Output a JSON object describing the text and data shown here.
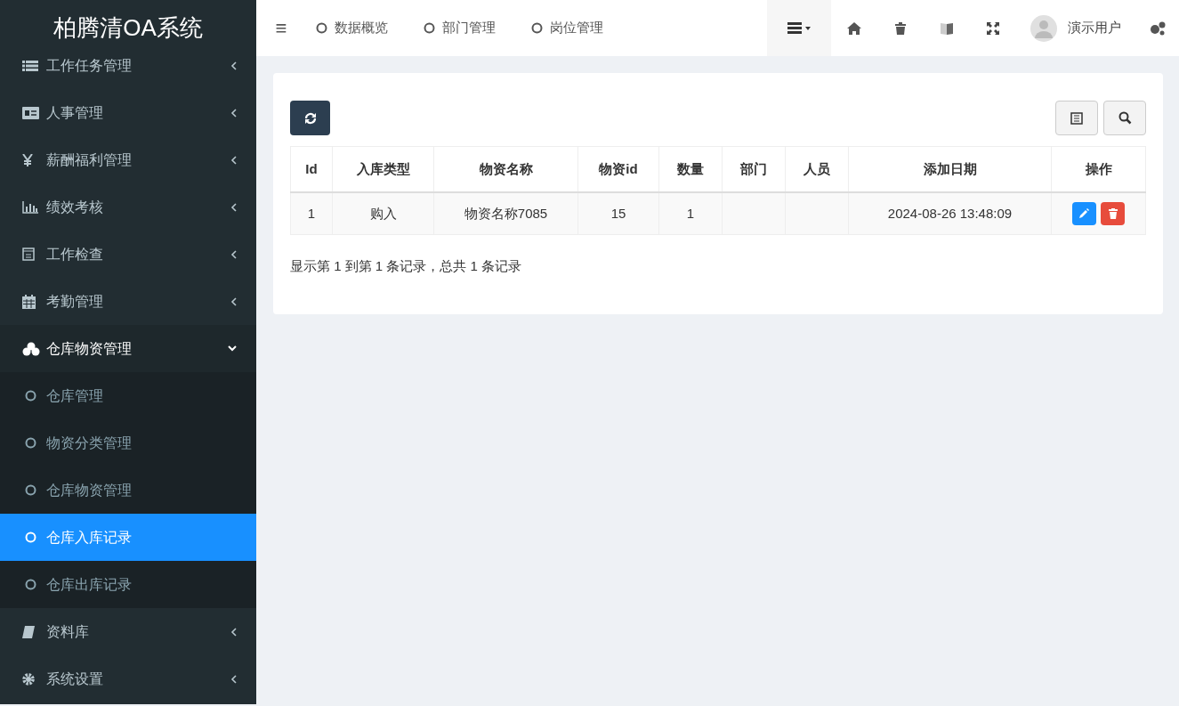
{
  "logo": "柏腾清OA系统",
  "sidebar": {
    "items": [
      {
        "label": "工作任务管理",
        "expanded": false
      },
      {
        "label": "人事管理",
        "expanded": false
      },
      {
        "label": "薪酬福利管理",
        "expanded": false
      },
      {
        "label": "绩效考核",
        "expanded": false
      },
      {
        "label": "工作检查",
        "expanded": false
      },
      {
        "label": "考勤管理",
        "expanded": false
      },
      {
        "label": "仓库物资管理",
        "expanded": true,
        "children": [
          {
            "label": "仓库管理",
            "selected": false
          },
          {
            "label": "物资分类管理",
            "selected": false
          },
          {
            "label": "仓库物资管理",
            "selected": false
          },
          {
            "label": "仓库入库记录",
            "selected": true
          },
          {
            "label": "仓库出库记录",
            "selected": false
          }
        ]
      },
      {
        "label": "资料库",
        "expanded": false
      },
      {
        "label": "系统设置",
        "expanded": false
      }
    ]
  },
  "topbar": {
    "menu_icon": "≡",
    "tabs": [
      {
        "label": "数据概览"
      },
      {
        "label": "部门管理"
      },
      {
        "label": "岗位管理"
      }
    ],
    "user": "演示用户"
  },
  "table": {
    "columns": [
      "Id",
      "入库类型",
      "物资名称",
      "物资id",
      "数量",
      "部门",
      "人员",
      "添加日期",
      "操作"
    ],
    "rows": [
      [
        "1",
        "购入",
        "物资名称7085",
        "15",
        "1",
        "",
        "",
        "2024-08-26 13:48:09"
      ]
    ]
  },
  "pagination_info": "显示第 1 到第 1 条记录，总共 1 条记录"
}
